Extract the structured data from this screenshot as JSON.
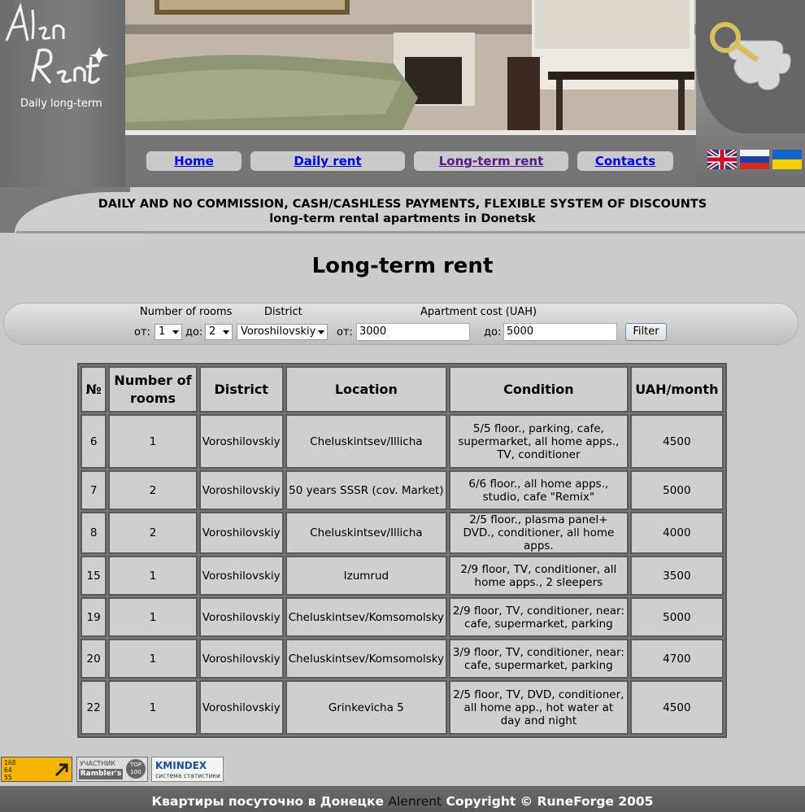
{
  "logo": {
    "subtitle": "Daily long-term"
  },
  "nav": [
    {
      "label": "Home"
    },
    {
      "label": "Daily rent"
    },
    {
      "label": "Long-term rent"
    },
    {
      "label": "Contacts"
    }
  ],
  "banner": {
    "line1": "DAILY AND NO COMMISSION, CASH/CASHLESS PAYMENTS, FLEXIBLE SYSTEM OF DISCOUNTS",
    "line2": "long-term rental apartments in Donetsk"
  },
  "page_title": "Long-term rent",
  "filter": {
    "rooms_label": "Number of rooms",
    "district_label": "District",
    "cost_label": "Apartment cost (UAH)",
    "from_label": "от:",
    "to_label": "до:",
    "rooms_from": "1",
    "rooms_to": "2",
    "district": "Voroshilovskiy",
    "cost_from": "3000",
    "cost_to": "5000",
    "button": "Filter"
  },
  "table": {
    "headers": [
      "№",
      "Number of rooms",
      "District",
      "Location",
      "Condition",
      "UAH/month"
    ],
    "rows": [
      [
        "6",
        "1",
        "Voroshilovskiy",
        "Cheluskintsev/Illicha",
        "5/5 floor., parking, cafe, supermarket, all home apps., TV, conditioner",
        "4500"
      ],
      [
        "7",
        "2",
        "Voroshilovskiy",
        "50 years SSSR (cov. Market)",
        "6/6 floor., all home apps., studio, cafe \"Remix\"",
        "5000"
      ],
      [
        "8",
        "2",
        "Voroshilovskiy",
        "Cheluskintsev/Illicha",
        "2/5 floor., plasma panel+ DVD., conditioner, all home apps.",
        "4000"
      ],
      [
        "15",
        "1",
        "Voroshilovskiy",
        "Izumrud",
        "2/9 floor, TV, conditioner, all home apps., 2 sleepers",
        "3500"
      ],
      [
        "19",
        "1",
        "Voroshilovskiy",
        "Cheluskintsev/Komsomolsky",
        "2/9 floor, TV, conditioner, near: cafe, supermarket, parking",
        "5000"
      ],
      [
        "20",
        "1",
        "Voroshilovskiy",
        "Cheluskintsev/Komsomolsky",
        "3/9 floor, TV, conditioner, near: cafe, supermarket, parking",
        "4700"
      ],
      [
        "22",
        "1",
        "Voroshilovskiy",
        "Grinkevicha 5",
        "2/5 floor, TV, DVD, conditioner, all home app., hot water at day and night",
        "4500"
      ]
    ]
  },
  "counters": {
    "c1": [
      "168",
      "64",
      "55"
    ],
    "c2_top": "УЧАСТНИК",
    "c2_main": "Rambler's",
    "c2_badge": "TOP 100",
    "c3_main": "KMINDEX",
    "c3_sub": "система статистики"
  },
  "footer": {
    "part1": "Квартиры посуточно в Донецке",
    "brand": "Alenrent",
    "part2": "Copyright © RuneForge 2005"
  },
  "colors": {
    "link": "#0000ee",
    "visited": "#551a8b",
    "background": "#cbcbcb"
  }
}
